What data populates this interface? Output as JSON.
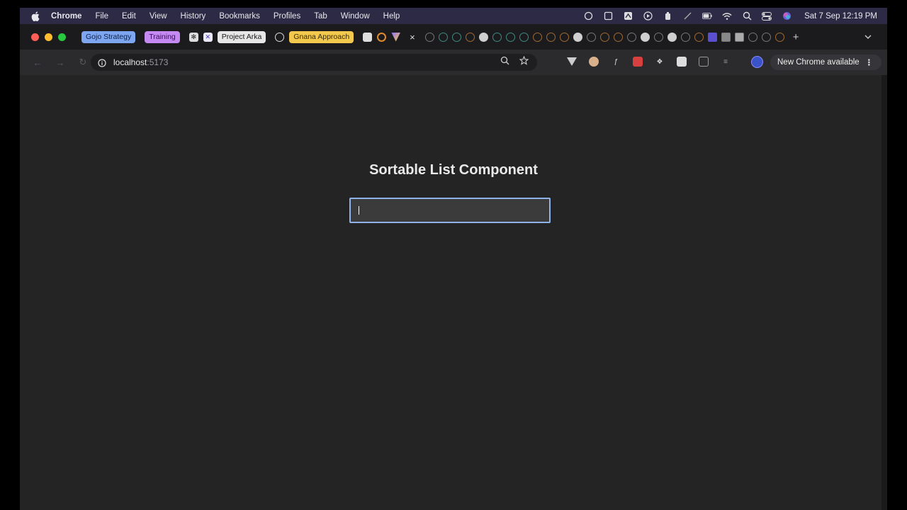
{
  "menubar": {
    "app_name": "Chrome",
    "items": [
      "File",
      "Edit",
      "View",
      "History",
      "Bookmarks",
      "Profiles",
      "Tab",
      "Window",
      "Help"
    ],
    "clock": "Sat 7 Sep  12:19 PM"
  },
  "tabs": {
    "groups": [
      {
        "label": "Gojo Strategy",
        "color": "#7ea6f0",
        "text_color": "#0b1f4a"
      },
      {
        "label": "Training",
        "color": "#c58af2",
        "text_color": "#3c0b5e"
      },
      {
        "label": "Project Arka",
        "color": "#e6e6e6",
        "text_color": "#1a1a1a"
      },
      {
        "label": "Gnana Approach",
        "color": "#f2c94c",
        "text_color": "#3a2a00"
      }
    ],
    "close_glyph": "×",
    "new_tab_glyph": "+"
  },
  "toolbar": {
    "url_host": "localhost",
    "url_port": ":5173",
    "new_chrome_label": "New Chrome available"
  },
  "page": {
    "title": "Sortable List Component",
    "input": {
      "value": "",
      "placeholder": ""
    }
  },
  "colors": {
    "page_bg": "#242424",
    "input_border": "#8fb3e8"
  }
}
